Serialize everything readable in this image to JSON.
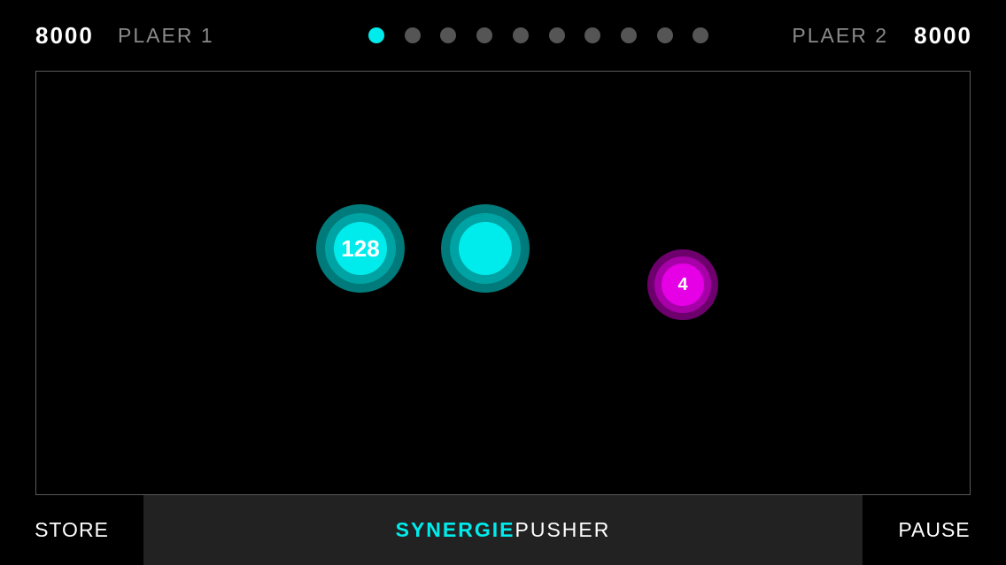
{
  "colors": {
    "background": "#000000",
    "accent_cyan": "#00ecec",
    "cyan_mid": "#00a3a3",
    "cyan_outer": "#007a7a",
    "magenta": "#e600e6",
    "magenta_mid": "#a800a8",
    "magenta_outer": "#6e006e",
    "dot_inactive": "#555555",
    "board_border": "#5a5a5a",
    "bottom_bar": "#222222"
  },
  "hud": {
    "player1": {
      "score": "8000",
      "name": "PLAER 1"
    },
    "player2": {
      "score": "8000",
      "name": "PLAER 2"
    },
    "rounds": {
      "total": 10,
      "current": 1
    }
  },
  "board": {
    "discs": [
      {
        "id": "disc-1",
        "owner": "cyan",
        "label": "128"
      },
      {
        "id": "disc-2",
        "owner": "cyan",
        "label": ""
      },
      {
        "id": "disc-3",
        "owner": "magenta",
        "label": "4"
      }
    ]
  },
  "bottom": {
    "store_label": "STORE",
    "title_part1": "SYNERGIE",
    "title_part2": "PUSHER",
    "pause_label": "PAUSE"
  }
}
